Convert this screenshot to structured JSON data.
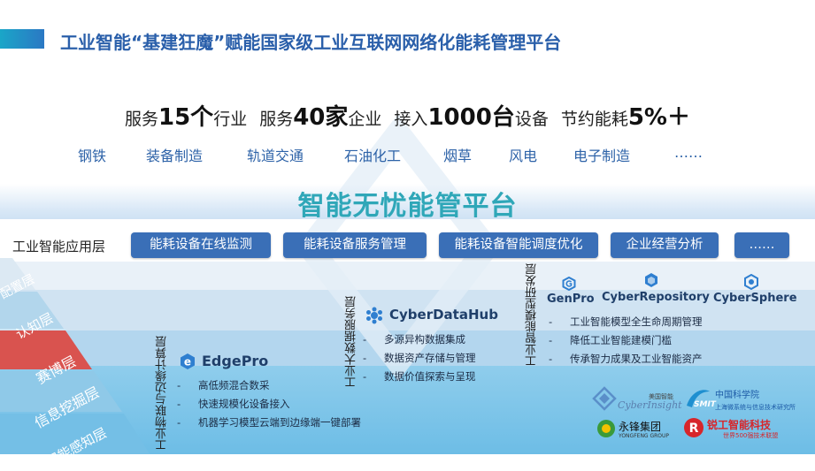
{
  "header": {
    "title": "工业智能“基建狂魔”赋能国家级工业互联网网络化能耗管理平台"
  },
  "stats": {
    "s1_pre": "服务",
    "s1_num": "15个",
    "s1_post": "行业",
    "s2_pre": "服务",
    "s2_num": "40家",
    "s2_post": "企业",
    "s3_pre": "接入",
    "s3_num": "1000台",
    "s3_post": "设备",
    "s4_pre": "节约能耗",
    "s4_num": "5%＋"
  },
  "industries": [
    "钢铁",
    "装备制造",
    "轨道交通",
    "石油化工",
    "烟草",
    "风电",
    "电子制造",
    "……"
  ],
  "platform": {
    "title": "智能无忧能管平台"
  },
  "app_layer": {
    "label": "工业智能应用层",
    "buttons": [
      "能耗设备在线监测",
      "能耗设备服务管理",
      "能耗设备智能调度优化",
      "企业经营分析",
      "……"
    ]
  },
  "pyramid": [
    "配置层",
    "认知层",
    "赛博层",
    "信息挖掘层",
    "智能感知层"
  ],
  "layers": {
    "edge": {
      "label": "工业物联与边缘计算层",
      "product": "EdgePro",
      "bullets": [
        "高低频混合数采",
        "快速规模化设备接入",
        "机器学习模型云端到边缘端一键部署"
      ]
    },
    "bigdata": {
      "label": "工业大数据服务层",
      "product": "CyberDataHub",
      "bullets": [
        "多源异构数据集成",
        "数据资产存储与管理",
        "数据价值探索与呈现"
      ]
    },
    "model": {
      "label": "工业智能模型研发层",
      "products": [
        "GenPro",
        "CyberRepository",
        "CyberSphere"
      ],
      "bullets": [
        "工业智能模型全生命周期管理",
        "降低工业智能建模门槛",
        "传承智力成果及工业智能资产"
      ]
    }
  },
  "partners": {
    "cyberinsight": "CyberInsight",
    "cyberinsight_cn": "美国智能",
    "smit_cn": "中国科学院",
    "smit_abbr": "SMIT",
    "smit_sub": "上海微系统与信息技术研究所",
    "yongfeng_cn": "永锋集团",
    "yongfeng_en": "YONGFENG GROUP",
    "ruigong_cn": "锐工智能科技",
    "ruigong_sub": "世界500强技术联盟"
  },
  "colors": {
    "title_blue": "#2a5faa",
    "platform_teal": "#2fa7b8",
    "button_blue": "#3a6fb7",
    "pyramid": [
      "#dce9f3",
      "#b2d6ec",
      "#d9534f",
      "#8fc9e8",
      "#74bfe6"
    ]
  }
}
